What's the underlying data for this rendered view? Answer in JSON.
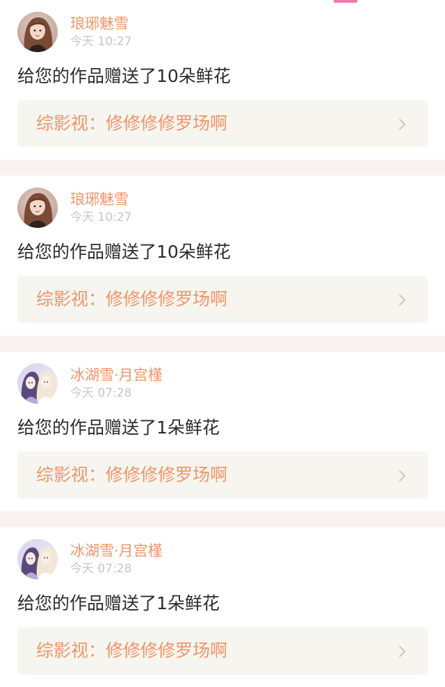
{
  "header": {
    "active_tab_indicator_color": "#ee7bab"
  },
  "notifications": [
    {
      "user_name": "琅琊魅雪",
      "time": "今天 10:27",
      "message": "给您的作品赠送了10朵鲜花",
      "work_title": "综影视：修修修修罗场啊",
      "avatar": "avatar-girl-brown-hair"
    },
    {
      "user_name": "琅琊魅雪",
      "time": "今天 10:27",
      "message": "给您的作品赠送了10朵鲜花",
      "work_title": "综影视：修修修修罗场啊",
      "avatar": "avatar-girl-brown-hair"
    },
    {
      "user_name": "冰湖雪·月宫槿",
      "time": "今天 07:28",
      "message": "给您的作品赠送了1朵鲜花",
      "work_title": "综影视：修修修修罗场啊",
      "avatar": "avatar-anime-girls"
    },
    {
      "user_name": "冰湖雪·月宫槿",
      "time": "今天 07:28",
      "message": "给您的作品赠送了1朵鲜花",
      "work_title": "综影视：修修修修罗场啊",
      "avatar": "avatar-anime-girls"
    }
  ],
  "colors": {
    "accent": "#f0956a",
    "page_bg": "#f8f2f3",
    "link_bg": "#f6f5ef",
    "time_text": "#c6c6c6",
    "body_text": "#2b2b2b"
  }
}
